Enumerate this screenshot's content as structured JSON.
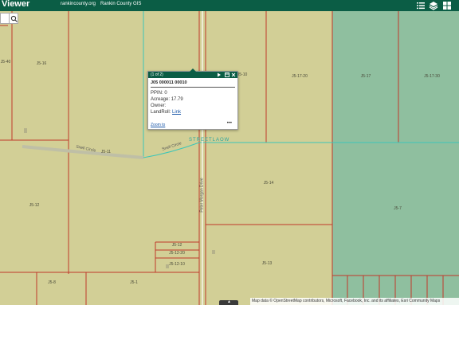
{
  "header": {
    "title": "Viewer",
    "link_county": "rankincounty.org",
    "link_gis": "Rankin County GIS",
    "icons": [
      "list-icon",
      "layers-icon",
      "grid-icon"
    ],
    "bg_color": "#0b5d45"
  },
  "search": {
    "placeholder": "",
    "icon": "search-icon"
  },
  "popup": {
    "count": "(1 of 2)",
    "title": "J05 000011 00010",
    "fields": [
      {
        "label": "PPIN:",
        "value": "0"
      },
      {
        "label": "Acreage:",
        "value": "17.79"
      },
      {
        "label": "Owner:",
        "value": ""
      },
      {
        "label": "LandRoll:",
        "value": "Link"
      }
    ],
    "zoom_label": "Zoom to",
    "more_label": "•••",
    "header_color": "#0b5d45"
  },
  "map": {
    "parcel_fill_color": "#d2cf96",
    "selected_fill_color": "#8fbf9f",
    "boundary_color": "#c0392b",
    "street_color": "#3cc6b8",
    "parcels": [
      {
        "label": "J5-16"
      },
      {
        "label": "J5-40"
      },
      {
        "label": "J5-10"
      },
      {
        "label": "J5-17-20"
      },
      {
        "label": "J5-17"
      },
      {
        "label": "J5-17-30"
      },
      {
        "label": "J5-11"
      },
      {
        "label": "J5-14"
      },
      {
        "label": "J5-12"
      },
      {
        "label": "J5-7"
      },
      {
        "label": "J5-12"
      },
      {
        "label": "J5-12-20"
      },
      {
        "label": "J5-12-10"
      },
      {
        "label": "J5-13"
      },
      {
        "label": "J5-8"
      },
      {
        "label": "J5-1"
      }
    ],
    "roads": [
      {
        "label": "Snell Circle"
      },
      {
        "label": "Snell Circle"
      },
      {
        "label": "Peter Morgan Drive"
      }
    ],
    "street_name": "STREETLAOW"
  },
  "attribution": "Map data © OpenStreetMap contributors, Microsoft, Facebook, Inc. and its affiliates, Esri Community Maps"
}
